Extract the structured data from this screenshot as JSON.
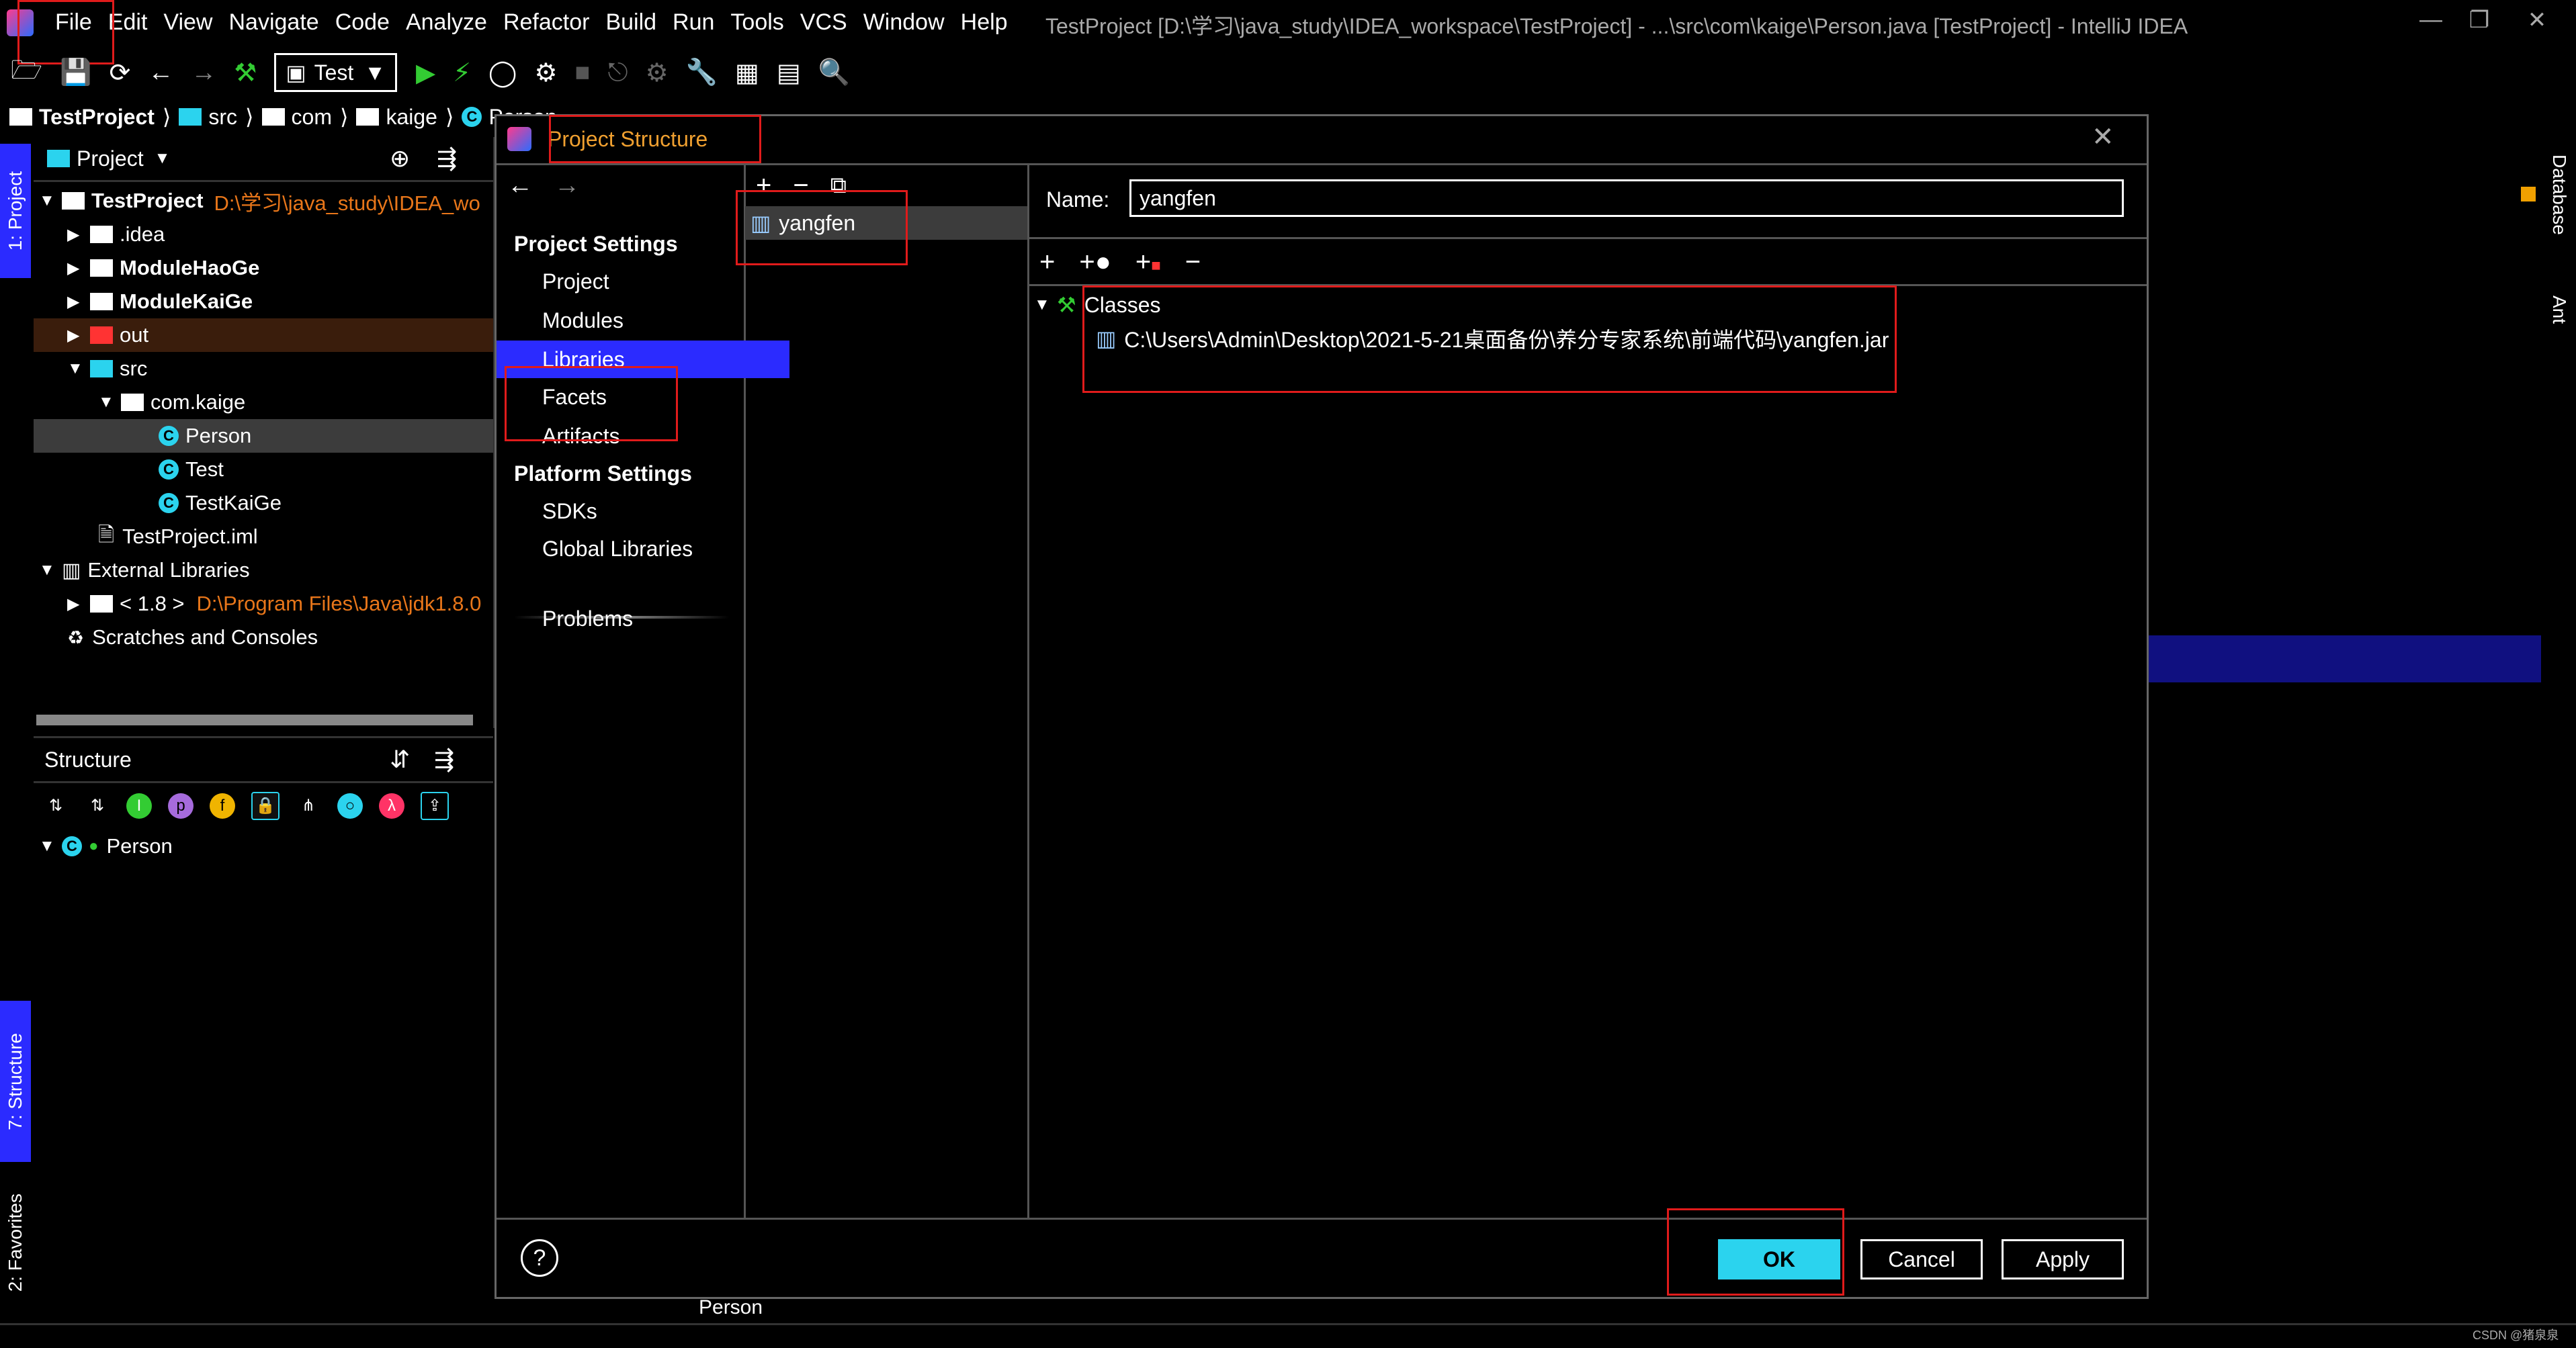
{
  "window": {
    "title": "TestProject [D:\\学习\\java_study\\IDEA_workspace\\TestProject] - ...\\src\\com\\kaige\\Person.java [TestProject] - IntelliJ IDEA"
  },
  "menu": [
    "File",
    "Edit",
    "View",
    "Navigate",
    "Code",
    "Analyze",
    "Refactor",
    "Build",
    "Run",
    "Tools",
    "VCS",
    "Window",
    "Help"
  ],
  "toolbar": {
    "run_config": "Test"
  },
  "breadcrumb": [
    "TestProject",
    "src",
    "com",
    "kaige",
    "Person"
  ],
  "left_tabs": {
    "project": "1: Project",
    "structure": "7: Structure",
    "favorites": "2: Favorites"
  },
  "right_tabs": {
    "database": "Database",
    "ant": "Ant"
  },
  "project_panel": {
    "title": "Project",
    "root_name": "TestProject",
    "root_path": "D:\\学习\\java_study\\IDEA_wo",
    "items": [
      ".idea",
      "ModuleHaoGe",
      "ModuleKaiGe",
      "out",
      "src",
      "com.kaige",
      "Person",
      "Test",
      "TestKaiGe",
      "TestProject.iml",
      "External Libraries"
    ],
    "jdk_label": "< 1.8 >",
    "jdk_path": "D:\\Program Files\\Java\\jdk1.8.0",
    "scratches": "Scratches and Consoles"
  },
  "structure_panel": {
    "title": "Structure",
    "root": "Person"
  },
  "dialog": {
    "title": "Project Structure",
    "project_settings": "Project Settings",
    "nav_items": [
      "Project",
      "Modules",
      "Libraries",
      "Facets",
      "Artifacts"
    ],
    "platform_settings": "Platform Settings",
    "platform_items": [
      "SDKs",
      "Global Libraries"
    ],
    "problems": "Problems",
    "library_name": "yangfen",
    "name_label": "Name:",
    "name_value": "yangfen",
    "classes_label": "Classes",
    "jar_path": "C:\\Users\\Admin\\Desktop\\2021-5-21桌面备份\\养分专家系统\\前端代码\\yangfen.jar",
    "ok": "OK",
    "cancel": "Cancel",
    "apply": "Apply",
    "help": "?"
  },
  "editor": {
    "tab_label": "Person"
  },
  "watermark": "CSDN @猪泉泉"
}
